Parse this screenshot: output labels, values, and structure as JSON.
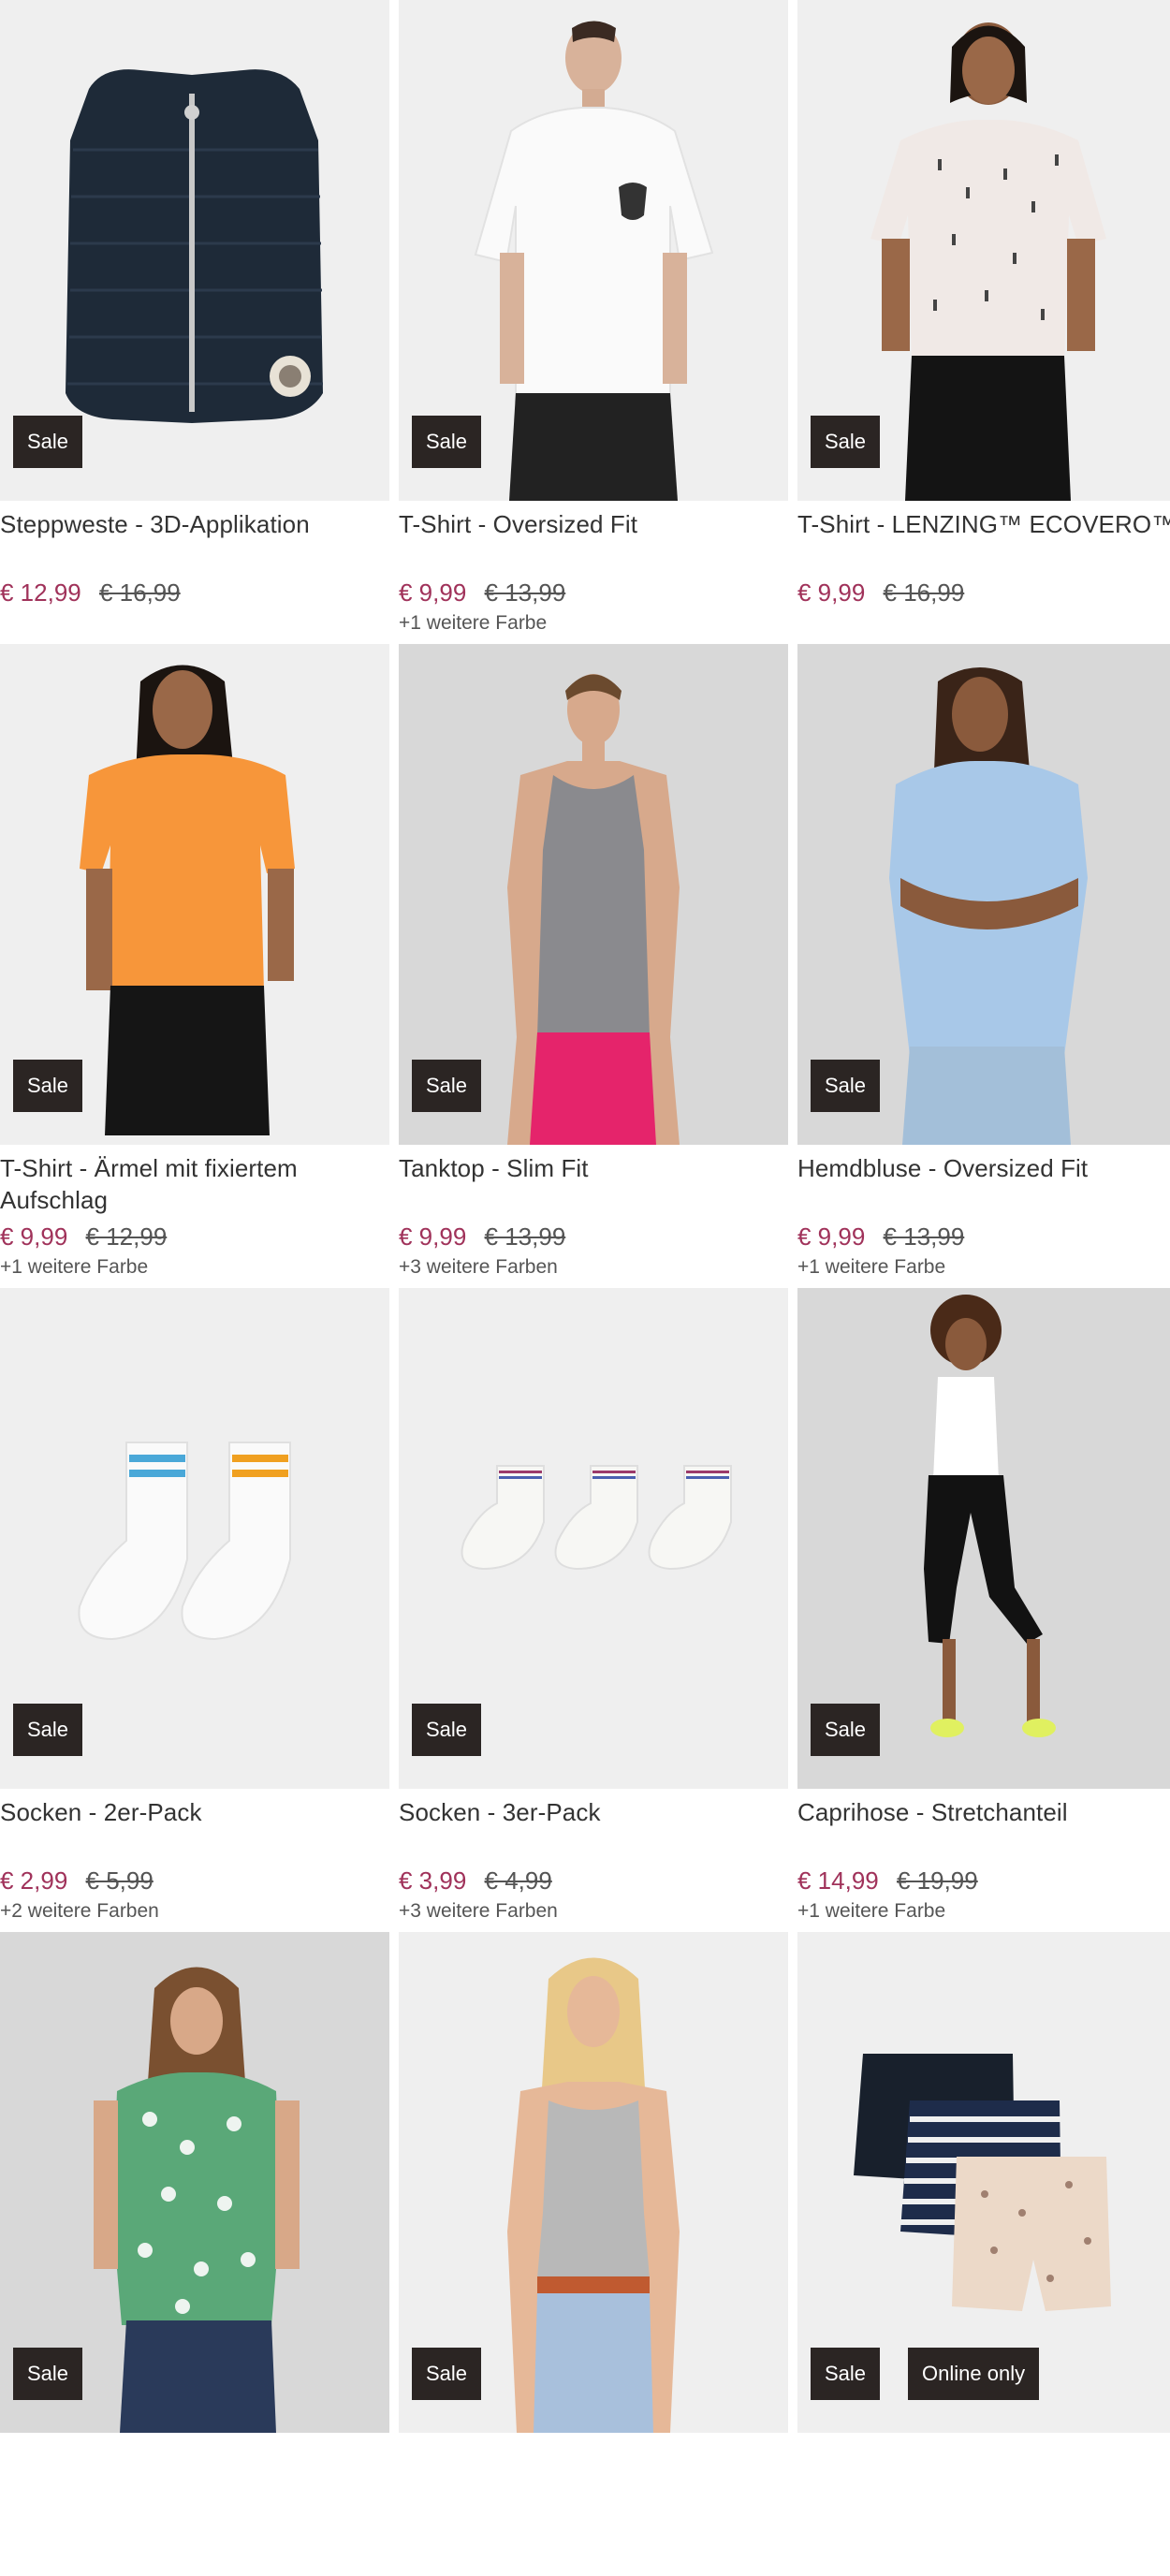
{
  "products": [
    {
      "title": "Steppweste - 3D-Applikation",
      "price": "€ 12,99",
      "old_price": "€ 16,99",
      "colors": "",
      "badges": [
        "Sale"
      ]
    },
    {
      "title": "T-Shirt - Oversized Fit",
      "price": "€ 9,99",
      "old_price": "€ 13,99",
      "colors": "+1 weitere Farbe",
      "badges": [
        "Sale"
      ]
    },
    {
      "title": "T-Shirt - LENZING™ ECOVERO™",
      "price": "€ 9,99",
      "old_price": "€ 16,99",
      "colors": "",
      "badges": [
        "Sale"
      ]
    },
    {
      "title": "T-Shirt - Ärmel mit fixiertem Aufschlag",
      "price": "€ 9,99",
      "old_price": "€ 12,99",
      "colors": "+1 weitere Farbe",
      "badges": [
        "Sale"
      ]
    },
    {
      "title": "Tanktop - Slim Fit",
      "price": "€ 9,99",
      "old_price": "€ 13,99",
      "colors": "+3 weitere Farben",
      "badges": [
        "Sale"
      ]
    },
    {
      "title": "Hemdbluse - Oversized Fit",
      "price": "€ 9,99",
      "old_price": "€ 13,99",
      "colors": "+1 weitere Farbe",
      "badges": [
        "Sale"
      ]
    },
    {
      "title": "Socken - 2er-Pack",
      "price": "€ 2,99",
      "old_price": "€ 5,99",
      "colors": "+2 weitere Farben",
      "badges": [
        "Sale"
      ]
    },
    {
      "title": "Socken - 3er-Pack",
      "price": "€ 3,99",
      "old_price": "€ 4,99",
      "colors": "+3 weitere Farben",
      "badges": [
        "Sale"
      ]
    },
    {
      "title": "Caprihose - Stretchanteil",
      "price": "€ 14,99",
      "old_price": "€ 19,99",
      "colors": "+1 weitere Farbe",
      "badges": [
        "Sale"
      ]
    },
    {
      "title": "",
      "price": "",
      "old_price": "",
      "colors": "",
      "badges": [
        "Sale"
      ]
    },
    {
      "title": "",
      "price": "",
      "old_price": "",
      "colors": "",
      "badges": [
        "Sale"
      ]
    },
    {
      "title": "",
      "price": "",
      "old_price": "",
      "colors": "",
      "badges": [
        "Sale",
        "Online only"
      ]
    }
  ],
  "colors": {
    "sale_badge": "#2b2523",
    "price": "#a0325a",
    "image_bg": "#f1f1f1"
  }
}
